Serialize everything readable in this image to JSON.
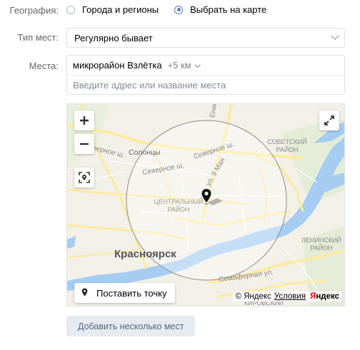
{
  "geography": {
    "label": "География:",
    "options": [
      "Города и регионы",
      "Выбрать на карте"
    ],
    "selected_index": 1
  },
  "place_type": {
    "label": "Тип мест:",
    "value": "Регулярно бывает"
  },
  "places": {
    "label": "Места:",
    "chip_name": "микрорайон Взлётка",
    "chip_radius": "+5 км",
    "address_placeholder": "Введите адрес или название места"
  },
  "map": {
    "zoom_in": "+",
    "zoom_out": "−",
    "place_point_label": "Поставить точку",
    "copyright": "© Яндекс",
    "terms": "Условия",
    "brand_red": "Я",
    "brand_rest": "ндекс",
    "labels": {
      "solontsy": "Солонцы",
      "severnoe1": "Северное ш.",
      "severnoe2": "Северное ш.",
      "severnoe3": "Северное ш.",
      "yeniseyskiy": "Енисейский тр.",
      "ul9maya": "ул. 9 Мая",
      "sovetskiy": "СОВЕТСКИЙ РАЙОН",
      "centralny": "ЦЕНТРАЛЬНЫЙ РАЙОН",
      "leninskiy": "ЛЕНИНСКИЙ РАЙОН",
      "krasnoyarsk": "Красноярск",
      "semafornaya": "Семафорная ул.",
      "kirovskiy": "КИРОВСКИЙ"
    },
    "colors": {
      "water": "#a5cdf2",
      "road": "#fde9a0",
      "land": "#f3f0e8",
      "circle_fill": "rgba(255,255,255,0.35)"
    }
  },
  "add_multiple_label": "Добавить несколько мест"
}
